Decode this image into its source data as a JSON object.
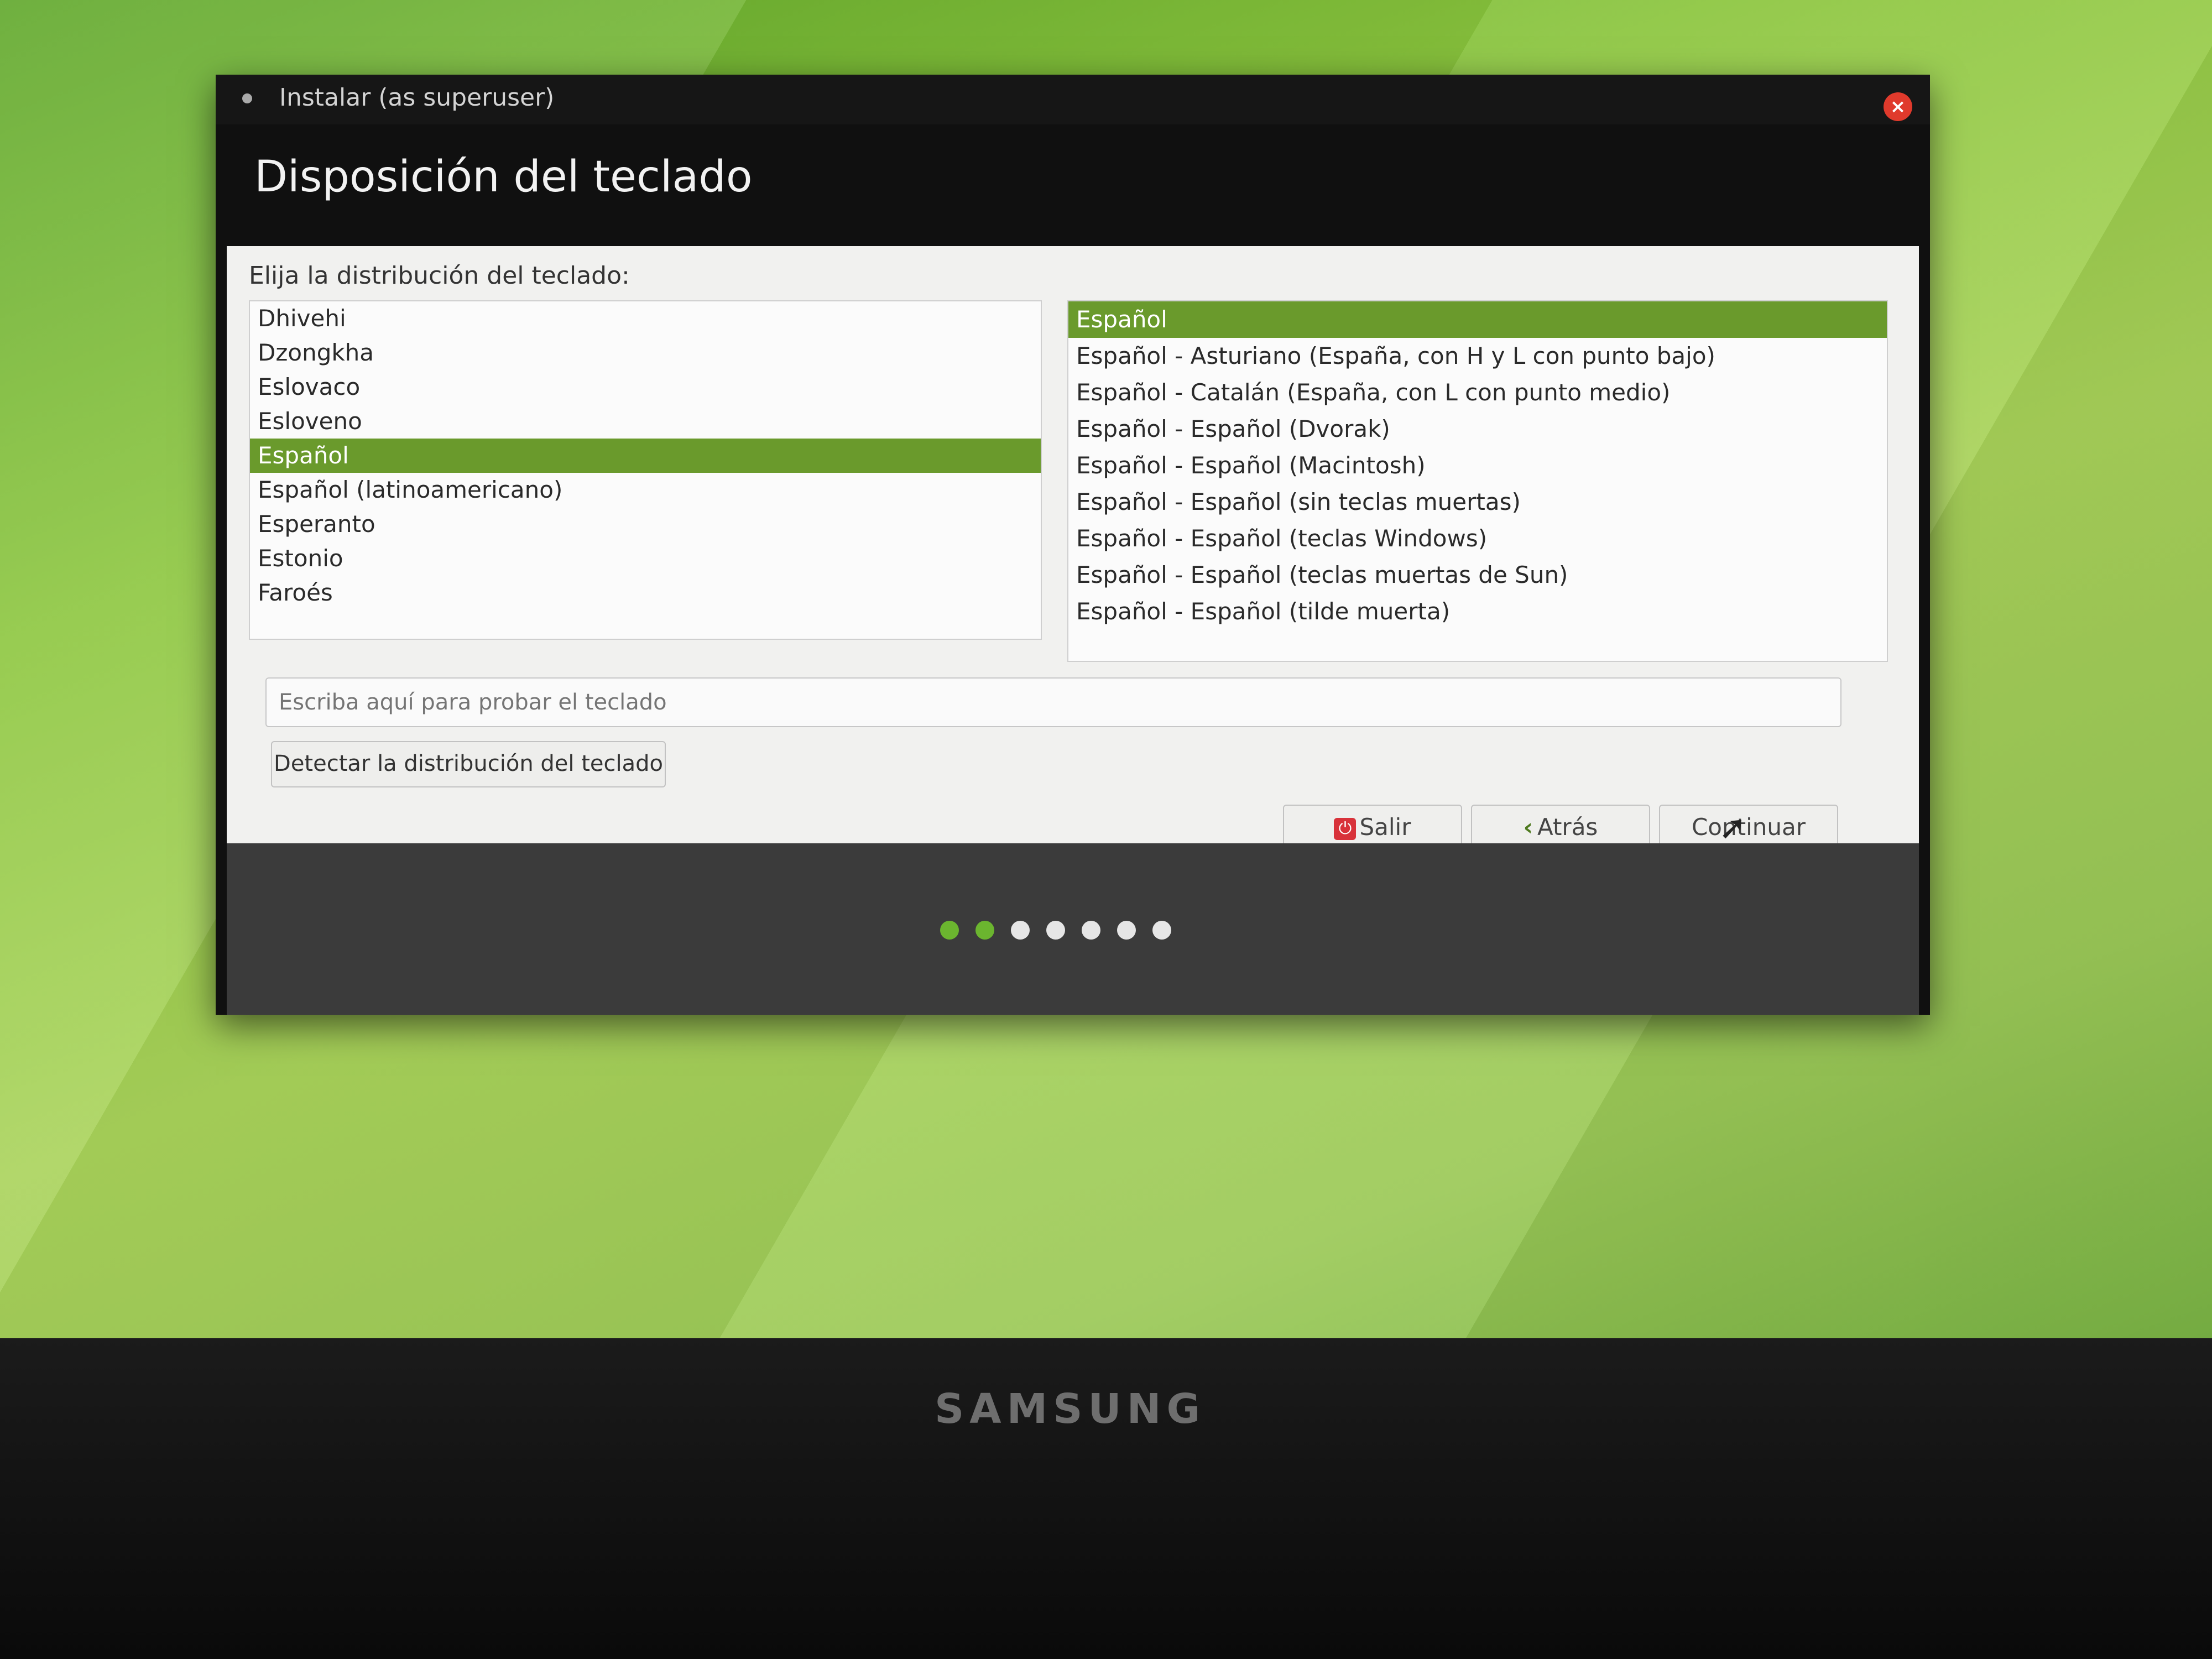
{
  "window": {
    "title": "Instalar (as superuser)",
    "close_glyph": "×",
    "page_title": "Disposición del teclado"
  },
  "content": {
    "prompt": "Elija la distribución del teclado:",
    "layouts": [
      "Dhivehi",
      "Dzongkha",
      "Eslovaco",
      "Esloveno",
      "Español",
      "Español (latinoamericano)",
      "Esperanto",
      "Estonio",
      "Faroés"
    ],
    "selected_layout": "Español",
    "variants": [
      "Español",
      "Español - Asturiano (España, con H y L con punto bajo)",
      "Español - Catalán (España, con L con punto medio)",
      "Español - Español (Dvorak)",
      "Español - Español (Macintosh)",
      "Español - Español (sin teclas muertas)",
      "Español - Español (teclas Windows)",
      "Español - Español (teclas muertas de Sun)",
      "Español - Español (tilde muerta)"
    ],
    "selected_variant": "Español",
    "test_placeholder": "Escriba aquí para probar el teclado",
    "detect_label": "Detectar la distribución del teclado"
  },
  "buttons": {
    "quit": "Salir",
    "back": "Atrás",
    "continue": "Continuar",
    "quit_icon": "power-icon",
    "back_icon": "chevron-left-icon",
    "back_glyph": "‹"
  },
  "progress": {
    "total_steps": 7,
    "completed_steps": 2
  },
  "monitor": {
    "brand": "SAMSUNG"
  },
  "colors": {
    "accent": "#6a9a2c",
    "progress_done": "#6bb52f",
    "close": "#e03a2c"
  }
}
